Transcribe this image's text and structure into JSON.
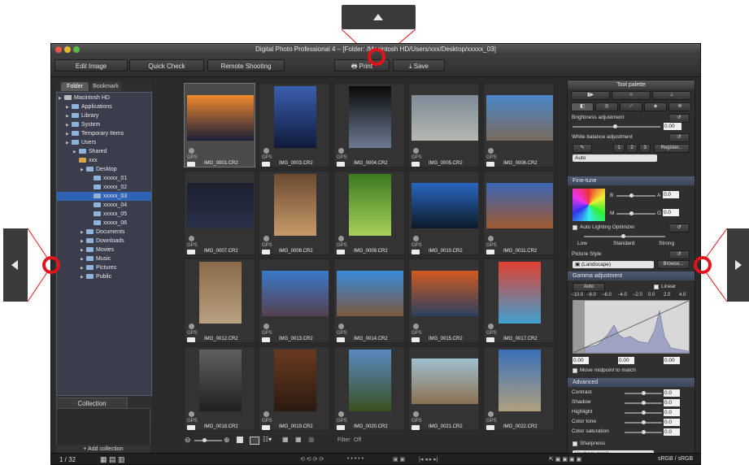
{
  "window": {
    "title": "Digital Photo Professional 4 – [Folder: /Macintosh HD/Users/xxx/Desktop/xxxxx_03]"
  },
  "toolbar": {
    "edit_image": "Edit Image",
    "quick_check": "Quick Check",
    "remote_shooting": "Remote Shooting",
    "print": "Print",
    "save": "Save"
  },
  "left_panel": {
    "tab_folder": "Folder",
    "tab_bookmark": "Bookmark",
    "tree": [
      {
        "label": "Macintosh HD",
        "depth": 0
      },
      {
        "label": "Applications",
        "depth": 1
      },
      {
        "label": "Library",
        "depth": 1
      },
      {
        "label": "System",
        "depth": 1
      },
      {
        "label": "Temporary Items",
        "depth": 1
      },
      {
        "label": "Users",
        "depth": 1
      },
      {
        "label": "Shared",
        "depth": 2
      },
      {
        "label": "xxx",
        "depth": 2
      },
      {
        "label": "Desktop",
        "depth": 3
      },
      {
        "label": "xxxxx_01",
        "depth": 4
      },
      {
        "label": "xxxxx_02",
        "depth": 4
      },
      {
        "label": "xxxxx_03",
        "depth": 4,
        "selected": true
      },
      {
        "label": "xxxxx_04",
        "depth": 4
      },
      {
        "label": "xxxxx_05",
        "depth": 4
      },
      {
        "label": "xxxxx_06",
        "depth": 4
      },
      {
        "label": "Documents",
        "depth": 3
      },
      {
        "label": "Downloads",
        "depth": 3
      },
      {
        "label": "Movies",
        "depth": 3
      },
      {
        "label": "Music",
        "depth": 3
      },
      {
        "label": "Pictures",
        "depth": 3
      },
      {
        "label": "Public",
        "depth": 3
      }
    ],
    "collection_tab": "Collection",
    "add_collection": "+ Add collection"
  },
  "images": [
    {
      "name": "IMG_0001.CR2",
      "gps": "GPS",
      "selected": true
    },
    {
      "name": "IMG_0003.CR2",
      "gps": "GPS"
    },
    {
      "name": "IMG_0004.CR2",
      "gps": "GPS"
    },
    {
      "name": "IMG_0005.CR2",
      "gps": "GPS"
    },
    {
      "name": "IMG_0006.CR2",
      "gps": "GPS"
    },
    {
      "name": "IMG_0007.CR2",
      "gps": "GPS"
    },
    {
      "name": "IMG_0008.CR2",
      "gps": "GPS"
    },
    {
      "name": "IMG_0009.CR2",
      "gps": "GPS"
    },
    {
      "name": "IMG_0010.CR2",
      "gps": "GPS"
    },
    {
      "name": "IMG_0011.CR2",
      "gps": "GPS"
    },
    {
      "name": "IMG_0012.CR2",
      "gps": "GPS"
    },
    {
      "name": "IMG_0013.CR2",
      "gps": "GPS"
    },
    {
      "name": "IMG_0014.CR2",
      "gps": "GPS"
    },
    {
      "name": "IMG_0015.CR2",
      "gps": "GPS"
    },
    {
      "name": "IMG_0017.CR2",
      "gps": "GPS"
    },
    {
      "name": "IMG_0018.CR2",
      "gps": "GPS"
    },
    {
      "name": "IMG_0019.CR2",
      "gps": "GPS"
    },
    {
      "name": "IMG_0020.CR2",
      "gps": "GPS"
    },
    {
      "name": "IMG_0021.CR2",
      "gps": "GPS"
    },
    {
      "name": "IMG_0022.CR2",
      "gps": "GPS"
    }
  ],
  "palette": {
    "title": "Tool palette",
    "brightness_label": "Brightness adjustment",
    "brightness_value": "0.00",
    "wb_label": "White balance adjustment",
    "wb_buttons": [
      "1",
      "2",
      "3"
    ],
    "wb_register": "Register...",
    "wb_select": "Auto",
    "finetune_header": "Fine-tune",
    "ft_b": "B",
    "ft_a": "A",
    "ft_m": "M",
    "ft_g": "G",
    "ft_a_value": "0.0",
    "ft_g_value": "0.0",
    "alo_label": "Auto Lighting Optimizer",
    "alo_low": "Low",
    "alo_standard": "Standard",
    "alo_strong": "Strong",
    "picture_style_label": "Picture Style",
    "picture_style_value": "(Landscape)",
    "browse": "Browse...",
    "gamma_header": "Gamma adjustment",
    "gamma_auto": "Auto",
    "gamma_linear": "Linear",
    "gamma_scale": [
      "−10.0",
      "−8.0",
      "−6.0",
      "−4.0",
      "−2.0",
      "0.0",
      "2.0",
      "4.0"
    ],
    "gamma_values": [
      "0.00",
      "0.00",
      "0.00"
    ],
    "move_midpoint": "Move midpoint to match",
    "advanced_header": "Advanced",
    "advanced_rows": [
      {
        "label": "Contrast",
        "value": "0.0"
      },
      {
        "label": "Shadow",
        "value": "0.0"
      },
      {
        "label": "Highlight",
        "value": "0.0"
      },
      {
        "label": "Color tone",
        "value": "0.0"
      },
      {
        "label": "Color saturation",
        "value": "0.0"
      }
    ],
    "sharpness_label": "Sharpness",
    "sharpness_select": "Unsharp mask"
  },
  "bottom": {
    "filter_label": "Filter",
    "filter_value": "Off",
    "count": "1 / 32",
    "color_space": "sRGB / sRGB"
  },
  "colors": {
    "selection": "#3163b5",
    "callout": "#e0141a"
  }
}
